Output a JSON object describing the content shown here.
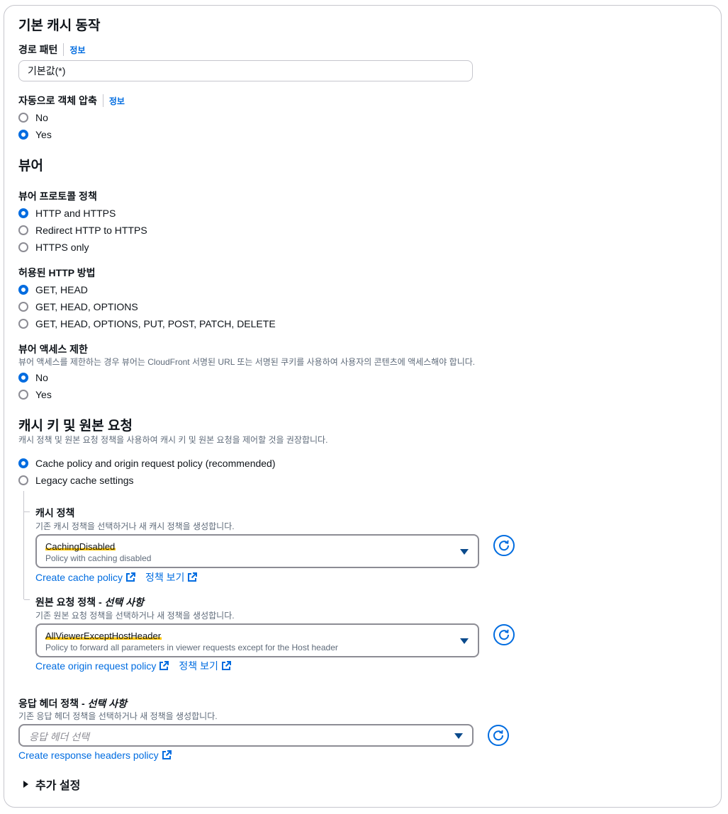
{
  "sections": {
    "default_behavior": {
      "title": "기본 캐시 동작",
      "path_pattern": {
        "label": "경로 패턴",
        "info": "정보",
        "value": "기본값(*)"
      },
      "compress": {
        "label": "자동으로 객체 압축",
        "info": "정보",
        "options": [
          "No",
          "Yes"
        ],
        "selected": "Yes"
      }
    },
    "viewer": {
      "title": "뷰어",
      "protocol": {
        "label": "뷰어 프로토콜 정책",
        "options": [
          "HTTP and HTTPS",
          "Redirect HTTP to HTTPS",
          "HTTPS only"
        ],
        "selected": "HTTP and HTTPS"
      },
      "methods": {
        "label": "허용된 HTTP 방법",
        "options": [
          "GET, HEAD",
          "GET, HEAD, OPTIONS",
          "GET, HEAD, OPTIONS, PUT, POST, PATCH, DELETE"
        ],
        "selected": "GET, HEAD"
      },
      "restrict": {
        "label": "뷰어 액세스 제한",
        "description": "뷰어 액세스를 제한하는 경우 뷰어는 CloudFront 서명된 URL 또는 서명된 쿠키를 사용하여 사용자의 콘텐츠에 액세스해야 합니다.",
        "options": [
          "No",
          "Yes"
        ],
        "selected": "No"
      }
    },
    "cache_key": {
      "title": "캐시 키 및 원본 요청",
      "description": "캐시 정책 및 원본 요청 정책을 사용하여 캐시 키 및 원본 요청을 제어할 것을 권장합니다.",
      "options": [
        "Cache policy and origin request policy (recommended)",
        "Legacy cache settings"
      ],
      "selected": "Cache policy and origin request policy (recommended)",
      "cache_policy": {
        "label": "캐시 정책",
        "description": "기존 캐시 정책을 선택하거나 새 캐시 정책을 생성합니다.",
        "value": "CachingDisabled",
        "value_description": "Policy with caching disabled",
        "create_link": "Create cache policy",
        "view_link": "정책 보기"
      },
      "origin_policy": {
        "label": "원본 요청 정책 - ",
        "label_optional": "선택 사항",
        "description": "기존 원본 요청 정책을 선택하거나 새 정책을 생성합니다.",
        "value": "AllViewerExceptHostHeader",
        "value_description": "Policy to forward all parameters in viewer requests except for the Host header",
        "create_link": "Create origin request policy",
        "view_link": "정책 보기"
      }
    },
    "response_headers": {
      "label": "응답 헤더 정책 - ",
      "label_optional": "선택 사항",
      "description": "기존 응답 헤더 정책을 선택하거나 새 정책을 생성합니다.",
      "placeholder": "응답 헤더 선택",
      "create_link": "Create response headers policy"
    },
    "additional": {
      "label": "추가 설정"
    }
  },
  "colors": {
    "accent": "#006ce0",
    "highlight": "#ffc400",
    "border": "#8c8c94"
  },
  "icons": {
    "refresh": "refresh-icon",
    "external": "external-link-icon",
    "caret": "caret-down-icon",
    "expand": "caret-right-icon"
  }
}
